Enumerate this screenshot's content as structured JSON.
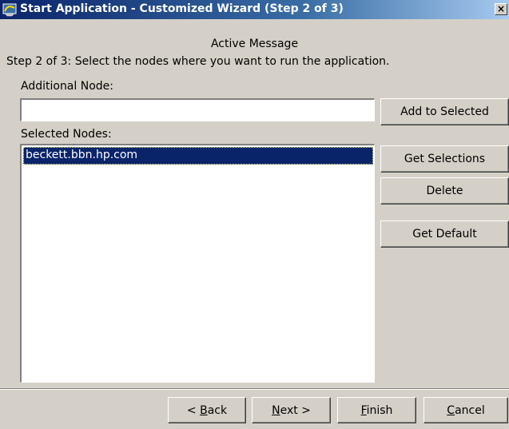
{
  "window": {
    "title": "Start Application - Customized Wizard (Step 2 of 3)",
    "close_glyph": "×",
    "icon": "application-icon"
  },
  "content": {
    "active_message": "Active Message",
    "instruction": "Step 2 of 3: Select the nodes where you want to run the application.",
    "additional_node_label": "Additional Node:",
    "additional_node_value": "",
    "selected_nodes_label": "Selected Nodes:",
    "selected_nodes": [
      "beckett.bbn.hp.com"
    ]
  },
  "side_buttons": {
    "add_to_selected": "Add to Selected",
    "get_selections": "Get Selections",
    "delete": "Delete",
    "get_default": "Get Default"
  },
  "footer_buttons": {
    "back_prefix": "< ",
    "back_mnemonic": "B",
    "back_rest": "ack",
    "next_mnemonic": "N",
    "next_rest": "ext >",
    "finish_mnemonic": "F",
    "finish_rest": "inish",
    "cancel_mnemonic": "C",
    "cancel_rest": "ancel"
  },
  "colors": {
    "dialog_bg": "#d4d0c8",
    "titlebar": "#0a246a",
    "selection": "#0a246a"
  }
}
